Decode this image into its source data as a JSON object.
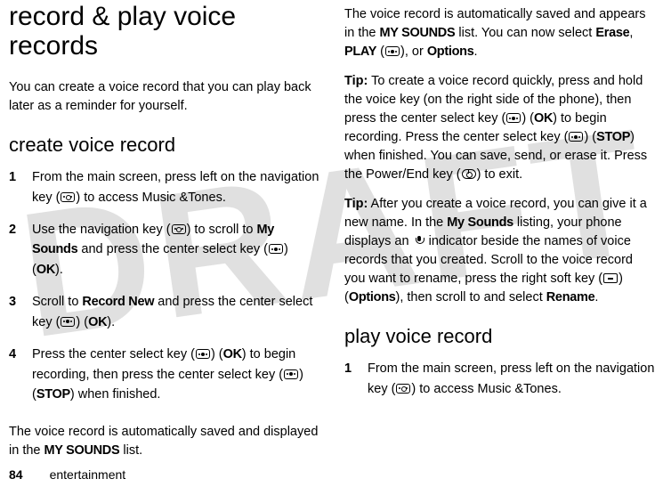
{
  "watermark": "DRAFT",
  "left": {
    "h1": "record & play voice records",
    "intro": "You can create a voice record that you can play back later as a reminder for yourself.",
    "h2": "create voice record",
    "steps": [
      {
        "n": "1",
        "pre": "From the main screen, press left on the navigation key (",
        "post": ") to access Music &Tones."
      },
      {
        "n": "2",
        "pre": "Use the navigation key (",
        "mid1": ") to scroll to ",
        "bold1": "My Sounds",
        "mid2": " and press the center select key (",
        "post": ") (",
        "lbl": "OK",
        "end": ")."
      },
      {
        "n": "3",
        "pre": "Scroll to ",
        "bold1": "Record New",
        "mid1": " and press the center select key (",
        "post": ") (",
        "lbl": "OK",
        "end": ")."
      },
      {
        "n": "4",
        "pre": "Press the center select key (",
        "mid1": ") (",
        "lbl1": "OK",
        "mid2": ") to begin recording, then press the center select key (",
        "post": ") (",
        "lbl2": "STOP",
        "end": ") when finished."
      }
    ],
    "outro_pre": "The voice record is automatically saved and displayed in the ",
    "outro_bold": "MY SOUNDS",
    "outro_post": " list."
  },
  "right": {
    "p1_pre": "The voice record is automatically saved and appears in the ",
    "p1_b1": "MY SOUNDS",
    "p1_mid1": " list. You can now select ",
    "p1_b2": "Erase",
    "p1_mid2": ", ",
    "p1_b3": "PLAY",
    "p1_mid3": " (",
    "p1_post": "), or ",
    "p1_b4": "Options",
    "p1_end": ".",
    "tip1_label": "Tip:",
    "tip1_a": " To create a voice record quickly, press and hold the voice key (on the right side of the phone), then press the center select key (",
    "tip1_b": ") (",
    "tip1_ok": "OK",
    "tip1_c": ") to begin recording. Press the center select key (",
    "tip1_d": ") (",
    "tip1_stop": "STOP",
    "tip1_e": ") when finished. You can save, send, or erase it. Press the Power/End key (",
    "tip1_f": ") to exit.",
    "tip2_label": "Tip:",
    "tip2_a": " After you create a voice record, you can give it a new name. In the ",
    "tip2_b1": "My Sounds",
    "tip2_b": " listing, your phone displays an ",
    "tip2_c": " indicator beside the names of voice records that you created. Scroll to the voice record you want to rename, press the right soft key (",
    "tip2_d": ") (",
    "tip2_opt": "Options",
    "tip2_e": "), then scroll to and select ",
    "tip2_b2": "Rename",
    "tip2_f": ".",
    "h2": "play voice record",
    "step1_n": "1",
    "step1_pre": "From the main screen, press left on the navigation key (",
    "step1_post": ") to access Music &Tones."
  },
  "footer": {
    "page": "84",
    "section": "entertainment"
  }
}
